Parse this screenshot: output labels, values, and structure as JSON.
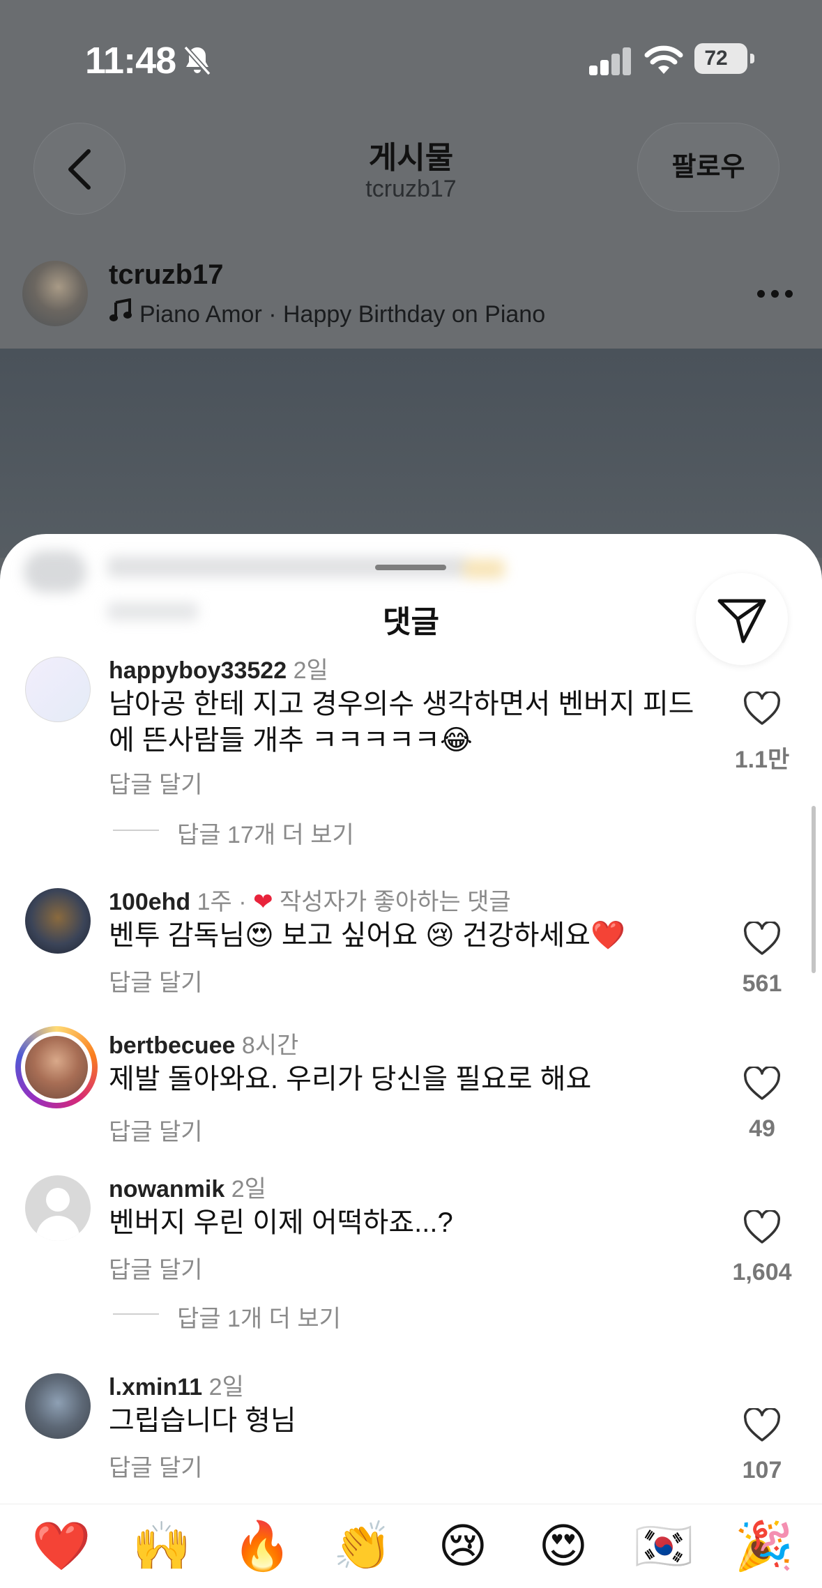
{
  "status_bar": {
    "time": "11:48",
    "battery": "72"
  },
  "header": {
    "title": "게시물",
    "subtitle": "tcruzb17",
    "follow_label": "팔로우"
  },
  "post": {
    "username": "tcruzb17",
    "music": "Piano Amor · Happy Birthday on Piano"
  },
  "sheet": {
    "title": "댓글"
  },
  "comments": [
    {
      "username": "happyboy33522",
      "time": "2일",
      "text_line1": "남아공 한테 지고 경우의수 생각하면서 벤버지 피드",
      "text_line2": "에 뜬사람들 개추 ㅋㅋㅋㅋㅋ😂",
      "reply_label": "답글 달기",
      "more_replies": "답글 17개 더 보기",
      "likes": "1.1만"
    },
    {
      "username": "100ehd",
      "time": "1주 ·",
      "liked_by_author": "작성자가 좋아하는 댓글",
      "text": "벤투 감독님😍  보고 싶어요 😢  건강하세요❤️",
      "reply_label": "답글 달기",
      "likes": "561"
    },
    {
      "username": "bertbecuee",
      "time": "8시간",
      "text": "제발 돌아와요. 우리가 당신을 필요로 해요",
      "reply_label": "답글 달기",
      "likes": "49"
    },
    {
      "username": "nowanmik",
      "time": "2일",
      "text": "벤버지 우린 이제 어떡하죠...?",
      "reply_label": "답글 달기",
      "more_replies": "답글 1개 더 보기",
      "likes": "1,604"
    },
    {
      "username": "l.xmin11",
      "time": "2일",
      "text": "그립습니다 형님",
      "reply_label": "답글 달기",
      "likes": "107"
    }
  ],
  "emoji_bar": [
    "❤️",
    "🙌",
    "🔥",
    "👏",
    "😢",
    "😍",
    "🇰🇷",
    "🎉"
  ],
  "colors": {
    "heart_red": "#e8233b",
    "story_ring": "#d6249f",
    "muted_text": "#8a8a8a"
  },
  "icons": {
    "back": "chevron-left-icon",
    "share": "paper-plane-icon",
    "like": "heart-outline-icon",
    "music": "music-note-icon",
    "more": "more-horizontal-icon"
  }
}
